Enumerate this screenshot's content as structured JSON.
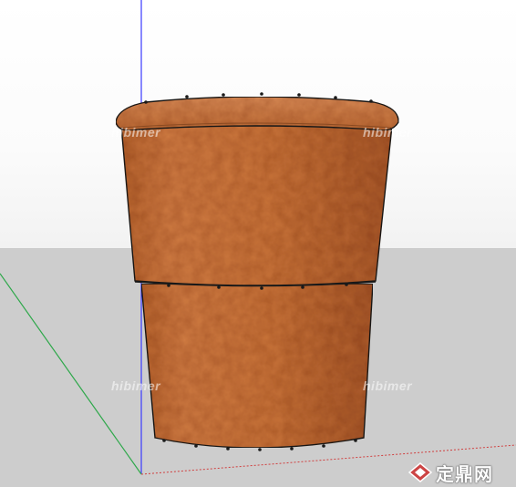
{
  "scene": {
    "object": "flower-pot",
    "pot_color": "#c7733a",
    "pot_shadow_color": "#a85b2a",
    "rim_color": "#d0804a",
    "edge_color": "#1a1a1a",
    "ground_color": "#cdcdcd",
    "axis_colors": {
      "blue": "#3a3aff",
      "green": "#2ea84a",
      "red": "#d04040"
    }
  },
  "watermarks": {
    "wm1": "hibimer",
    "wm2": "hibimer",
    "wm3": "hibimer",
    "wm4": "hibimer"
  },
  "brand": {
    "text": "定鼎网",
    "icon": "brand-diamond-icon"
  }
}
